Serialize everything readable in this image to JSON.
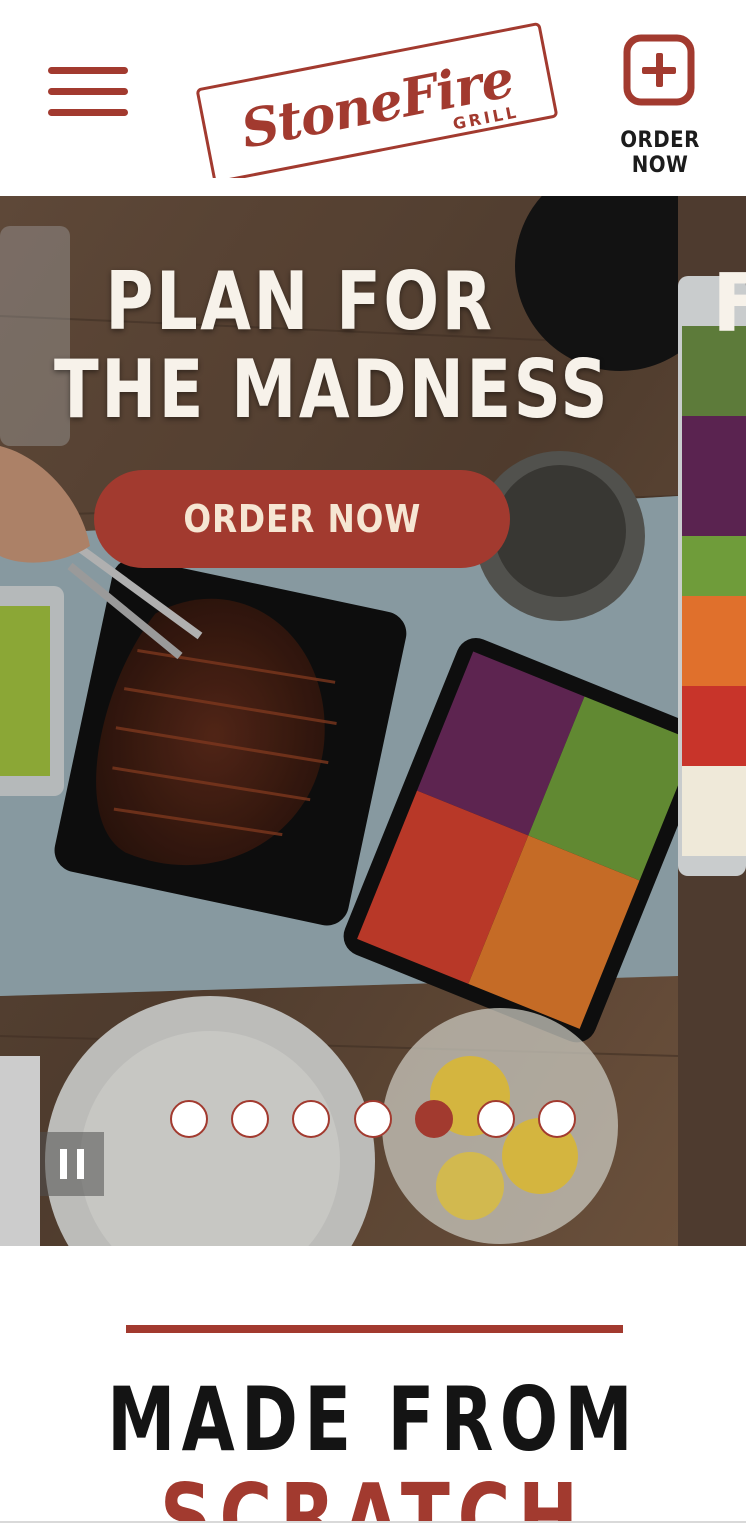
{
  "header": {
    "menu_icon": "hamburger-menu-icon",
    "logo_primary": "StoneFire",
    "logo_secondary": "GRILL",
    "order_icon": "plus-square-icon",
    "order_label": "ORDER NOW"
  },
  "hero": {
    "title_line1": "PLAN FOR",
    "title_line2": "THE MADNESS",
    "cta_label": "ORDER NOW",
    "next_slide_title_fragment": "F",
    "slide_count": 7,
    "active_slide": 5,
    "pause_icon": "pause-icon"
  },
  "section": {
    "title_line1": "MADE FROM",
    "title_line2": "SCRATCH"
  },
  "colors": {
    "brand_red": "#a23a2f",
    "cta_text": "#f6e6d3",
    "hero_text": "#f7f2ea",
    "dark_text": "#141414"
  }
}
